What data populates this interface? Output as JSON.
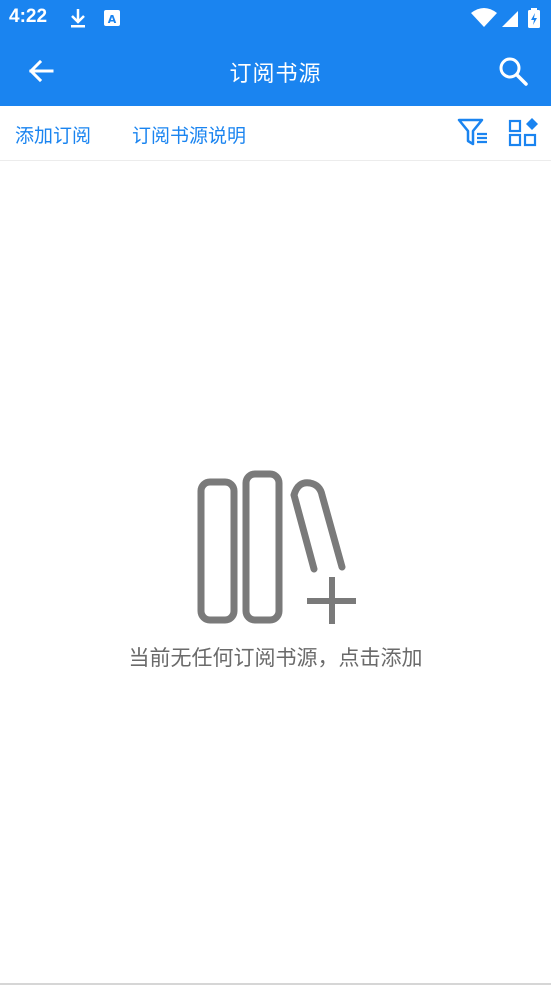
{
  "status_bar": {
    "time": "4:22",
    "icons": [
      "download-icon",
      "app-a-icon",
      "wifi-icon",
      "signal-icon",
      "battery-charging-icon"
    ]
  },
  "app_bar": {
    "title": "订阅书源",
    "back_icon": "arrow-left-icon",
    "search_icon": "search-icon"
  },
  "toolbar": {
    "add_label": "添加订阅",
    "help_label": "订阅书源说明",
    "filter_icon": "filter-icon",
    "layout_icon": "grid-layout-icon"
  },
  "empty_state": {
    "icon": "bookshelf-add-icon",
    "message": "当前无任何订阅书源，点击添加"
  },
  "colors": {
    "primary": "#1a84f0",
    "link": "#1a84f0",
    "empty_text": "#6a6a6a",
    "illustration": "#7a7a7a"
  }
}
